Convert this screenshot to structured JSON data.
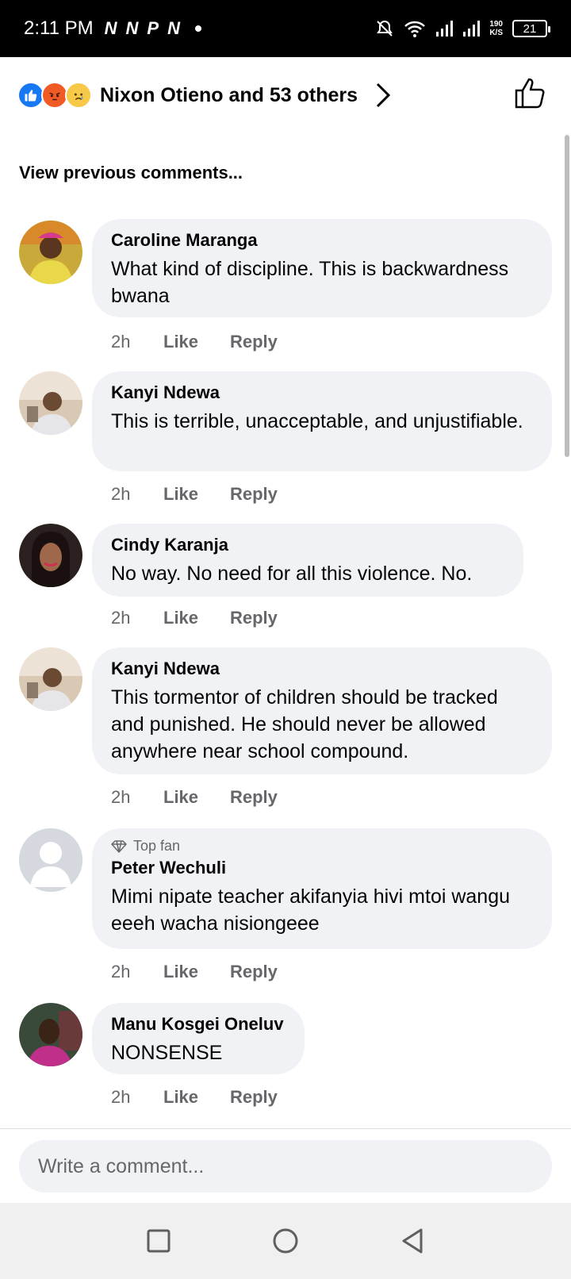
{
  "status_bar": {
    "time": "2:11 PM",
    "notification_icons": [
      "N",
      "N",
      "P",
      "N"
    ],
    "net_speed_value": "190",
    "net_speed_unit": "K/S",
    "battery": "21"
  },
  "reactions": {
    "icons": [
      "like-icon",
      "angry-icon",
      "sad-icon"
    ],
    "text": "Nixon Otieno and 53 others"
  },
  "view_previous": "View previous comments...",
  "comments": [
    {
      "name": "Caroline Maranga",
      "text": "What kind of discipline. This is backwardness bwana",
      "time": "2h",
      "like": "Like",
      "reply": "Reply"
    },
    {
      "name": "Kanyi Ndewa",
      "text": "This is terrible, unacceptable, and unjustifiable.",
      "time": "2h",
      "like": "Like",
      "reply": "Reply"
    },
    {
      "name": "Cindy Karanja",
      "text": "No way. No need for all this violence. No.",
      "time": "2h",
      "like": "Like",
      "reply": "Reply"
    },
    {
      "name": "Kanyi Ndewa",
      "text": "This tormentor of children should be tracked and punished. He should never be allowed anywhere near school compound.",
      "time": "2h",
      "like": "Like",
      "reply": "Reply"
    },
    {
      "badge": "Top fan",
      "name": "Peter Wechuli",
      "text": "Mimi nipate teacher akifanyia hivi mtoi wangu eeeh wacha nisiongeee",
      "time": "2h",
      "like": "Like",
      "reply": "Reply"
    },
    {
      "name": "Manu Kosgei Oneluv",
      "text": "NONSENSE",
      "time": "2h",
      "like": "Like",
      "reply": "Reply"
    }
  ],
  "composer": {
    "placeholder": "Write a comment..."
  },
  "colors": {
    "bubble": "#f0f2f5",
    "secondary_text": "#65676b",
    "like_blue": "#1877f2"
  }
}
